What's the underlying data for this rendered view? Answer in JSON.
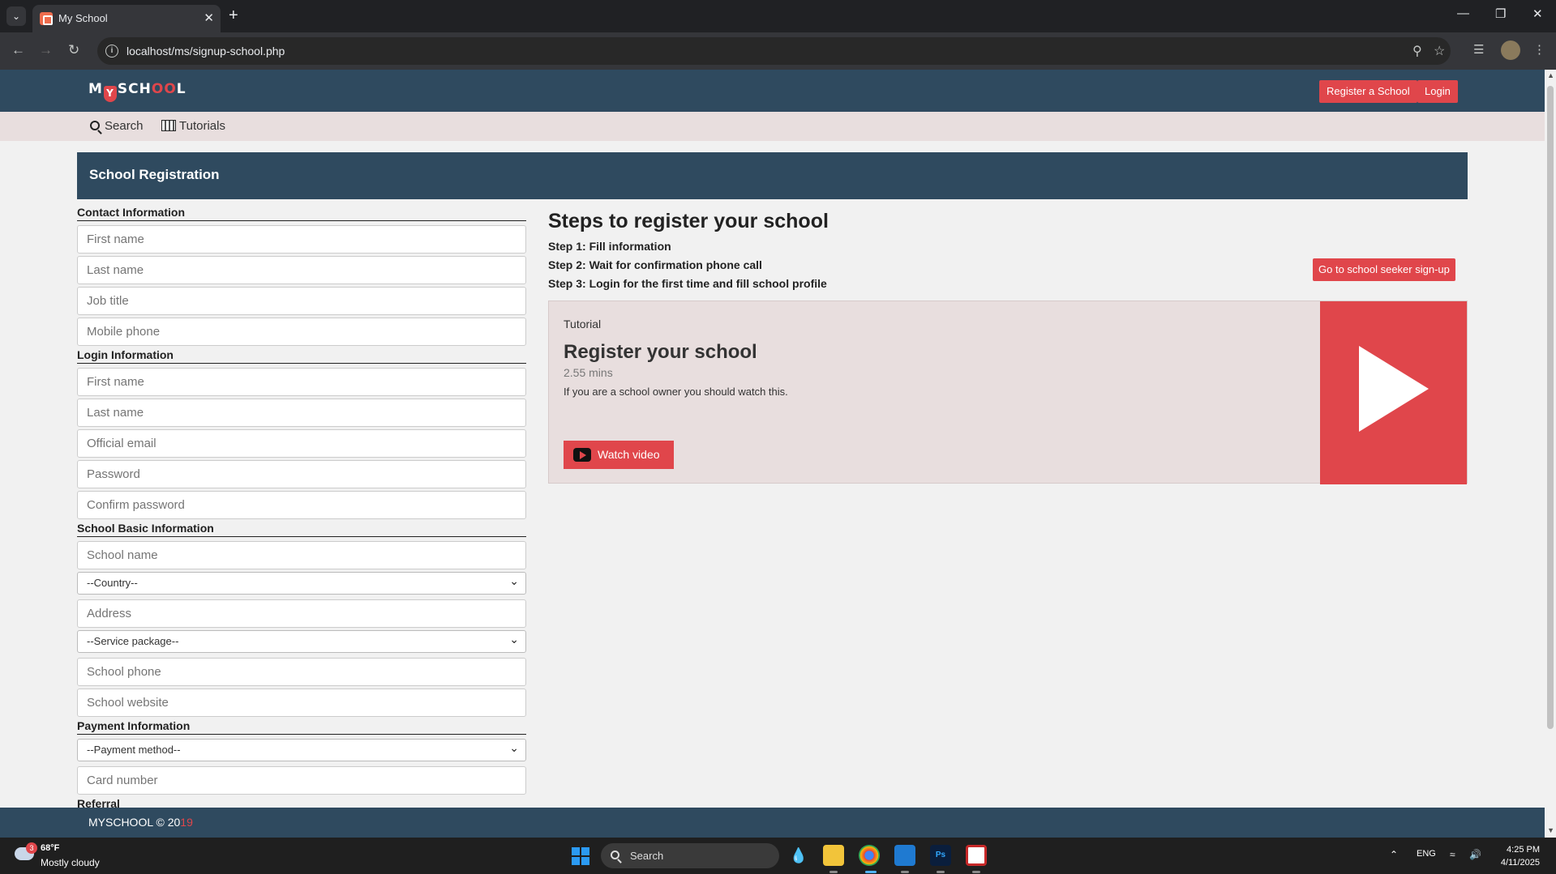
{
  "browser": {
    "tab_title": "My School",
    "url": "localhost/ms/signup-school.php"
  },
  "header": {
    "logo_prefix": "M",
    "logo_shield": "Y",
    "logo_mid": "SCH",
    "logo_red": "OO",
    "logo_suffix": "L",
    "register_label": "Register a School",
    "login_label": "Login"
  },
  "subnav": {
    "search_label": "Search",
    "tutorials_label": "Tutorials"
  },
  "panel": {
    "title": "School Registration",
    "seeker_button": "Go to school seeker sign-up"
  },
  "form": {
    "contact": {
      "title": "Contact Information",
      "first_name": "First name",
      "last_name": "Last name",
      "job_title": "Job title",
      "mobile": "Mobile phone"
    },
    "login": {
      "title": "Login Information",
      "first_name": "First name",
      "last_name": "Last name",
      "email": "Official email",
      "password": "Password",
      "confirm_password": "Confirm password"
    },
    "school": {
      "title": "School Basic Information",
      "name": "School name",
      "country": "--Country--",
      "address": "Address",
      "service": "--Service package--",
      "phone": "School phone",
      "website": "School website"
    },
    "payment": {
      "title": "Payment Information",
      "method": "--Payment method--",
      "card": "Card number"
    },
    "referral": {
      "title": "Referral"
    }
  },
  "steps": {
    "title": "Steps to register your school",
    "step1": "Step 1: Fill information",
    "step2": "Step 2: Wait for confirmation phone call",
    "step3": "Step 3: Login for the first time and fill school profile"
  },
  "tutorial": {
    "label": "Tutorial",
    "title": "Register your school",
    "duration": "2.55 mins",
    "description": "If you are a school owner you should watch this.",
    "button": "Watch video"
  },
  "footer": {
    "text": "MYSCHOOL © 20",
    "year_red": "19"
  },
  "taskbar": {
    "weather_badge": "3",
    "temperature": "68°F",
    "weather": "Mostly cloudy",
    "search": "Search",
    "language": "ENG",
    "time": "4:25 PM",
    "date": "4/11/2025"
  },
  "colors": {
    "header_bg": "#2f4a5f",
    "accent_red": "#e0464b",
    "subnav_bg": "#e8dede",
    "page_bg": "#f1f1f1"
  }
}
